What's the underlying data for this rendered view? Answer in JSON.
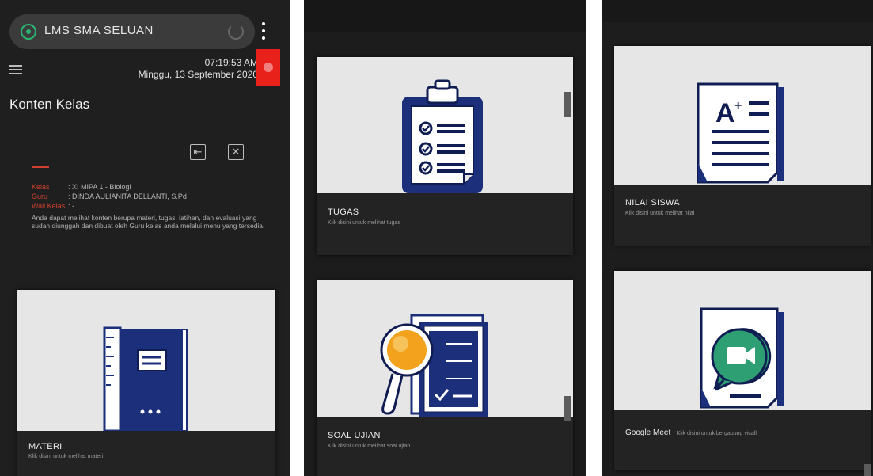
{
  "browser": {
    "url": "LMS SMA SELUAN",
    "lock_icon": "shield-lock-icon",
    "reload_icon": "reload-icon",
    "menu_icon": "kebab-menu-icon"
  },
  "header": {
    "time": "07:19:53 AM",
    "date": "Minggu, 13 September 2020",
    "user_icon": "user-icon"
  },
  "page": {
    "title": "Konten Kelas"
  },
  "kelas_info": {
    "rows": [
      {
        "key": "Kelas",
        "value": ": XI MIPA 1 - Biologi"
      },
      {
        "key": "Guru",
        "value": ": DINDA AULIANITA DELLANTI, S.Pd"
      },
      {
        "key": "Wali Kelas",
        "value": ": -"
      }
    ],
    "description": "Anda dapat melihat konten berupa materi, tugas, latihan, dan evaluasi yang sudah diunggah dan dibuat oleh Guru kelas anda melalui menu yang tersedia."
  },
  "cards": {
    "materi": {
      "title": "MATERI",
      "subtitle": "Klik disini untuk melihat materi"
    },
    "tugas": {
      "title": "TUGAS",
      "subtitle": "Klik disini untuk melihat tugas"
    },
    "soal": {
      "title": "SOAL UJIAN",
      "subtitle": "Klik disini untuk melihat soal ujian"
    },
    "nilai": {
      "title": "NILAI SISWA",
      "subtitle": "Klik disini untuk melihat nilai"
    },
    "meet": {
      "title": "Google Meet",
      "subtitle": "Klik disini untuk bergabung vicall"
    }
  },
  "colors": {
    "accent_red": "#e8221b",
    "label_red": "#d0402e",
    "navy": "#1c2f7a",
    "meet_green": "#2e9e73",
    "magnifier_orange": "#f2a21c"
  }
}
